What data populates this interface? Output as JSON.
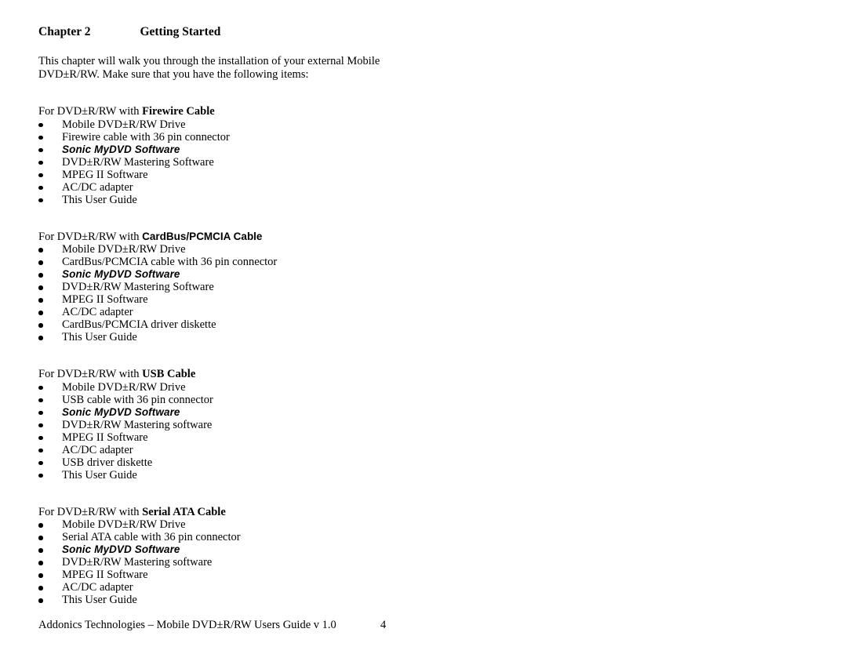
{
  "document": {
    "chapter_label": "Chapter 2",
    "chapter_title": "Getting Started",
    "intro_line_1": "This chapter will walk you through the installation of your external Mobile",
    "intro_line_2": "DVD±R/RW. Make sure that you have the following items:"
  },
  "sections": [
    {
      "heading_prefix": "For DVD±R/RW with ",
      "heading_cable": "Firewire Cable",
      "heading_cable_font": "serif",
      "items": [
        {
          "text": "Mobile DVD±R/RW Drive",
          "emphasis": false
        },
        {
          "text": "Firewire cable with 36 pin connector",
          "emphasis": false
        },
        {
          "text": "Sonic MyDVD Software",
          "emphasis": true
        },
        {
          "text": "DVD±R/RW Mastering Software",
          "emphasis": false
        },
        {
          "text": "MPEG II Software",
          "emphasis": false
        },
        {
          "text": "AC/DC adapter",
          "emphasis": false
        },
        {
          "text": "This User Guide",
          "emphasis": false
        }
      ]
    },
    {
      "heading_prefix": "For DVD±R/RW with ",
      "heading_cable": "CardBus/PCMCIA Cable",
      "heading_cable_font": "sans",
      "items": [
        {
          "text": "Mobile DVD±R/RW Drive",
          "emphasis": false
        },
        {
          "text": "CardBus/PCMCIA cable with 36 pin connector",
          "emphasis": false
        },
        {
          "text": "Sonic MyDVD Software",
          "emphasis": true
        },
        {
          "text": "DVD±R/RW Mastering Software",
          "emphasis": false
        },
        {
          "text": "MPEG II Software",
          "emphasis": false
        },
        {
          "text": "AC/DC adapter",
          "emphasis": false
        },
        {
          "text": "CardBus/PCMCIA driver diskette",
          "emphasis": false
        },
        {
          "text": "This User Guide",
          "emphasis": false
        }
      ]
    },
    {
      "heading_prefix": "For DVD±R/RW with ",
      "heading_cable": "USB Cable",
      "heading_cable_font": "serif",
      "items": [
        {
          "text": "Mobile DVD±R/RW Drive",
          "emphasis": false
        },
        {
          "text": "USB cable with 36 pin connector",
          "emphasis": false
        },
        {
          "text": "Sonic MyDVD Software",
          "emphasis": true
        },
        {
          "text": "DVD±R/RW Mastering software",
          "emphasis": false
        },
        {
          "text": "MPEG II Software",
          "emphasis": false
        },
        {
          "text": "AC/DC adapter",
          "emphasis": false
        },
        {
          "text": "USB driver diskette",
          "emphasis": false
        },
        {
          "text": "This User Guide",
          "emphasis": false
        }
      ]
    },
    {
      "heading_prefix": "For DVD±R/RW with ",
      "heading_cable": "Serial ATA Cable",
      "heading_cable_font": "serif",
      "items": [
        {
          "text": "Mobile DVD±R/RW Drive",
          "emphasis": false
        },
        {
          "text": "Serial ATA cable with 36 pin connector",
          "emphasis": false
        },
        {
          "text": "Sonic MyDVD Software",
          "emphasis": true
        },
        {
          "text": "DVD±R/RW Mastering software",
          "emphasis": false
        },
        {
          "text": "MPEG II Software",
          "emphasis": false
        },
        {
          "text": "AC/DC adapter",
          "emphasis": false
        },
        {
          "text": "This User Guide",
          "emphasis": false
        }
      ]
    }
  ],
  "footer": {
    "text": "Addonics Technologies – Mobile DVD±R/RW Users Guide v 1.0",
    "page_number": "4"
  }
}
